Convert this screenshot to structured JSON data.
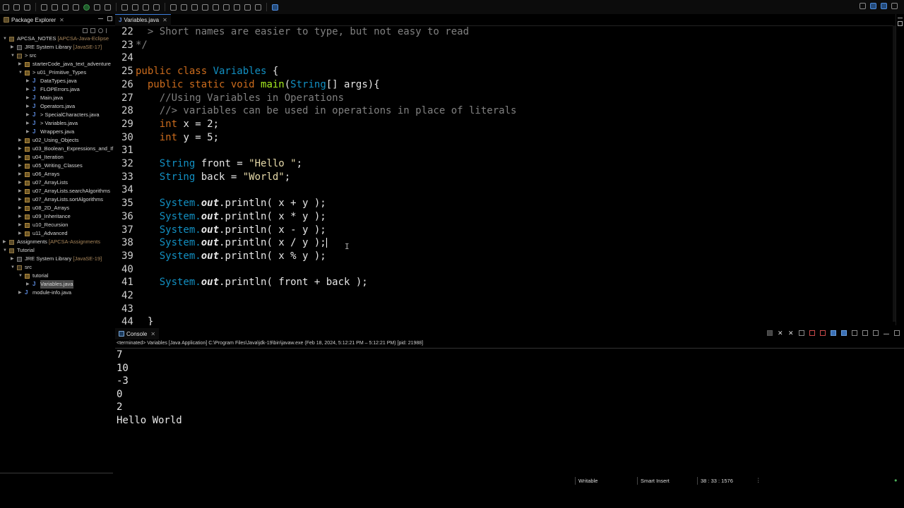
{
  "package_explorer": {
    "tab_label": "Package Explorer",
    "tree": [
      {
        "label": "APCSA_NOTES",
        "decoration": "[APCSA-Java-Eclipse",
        "depth": 0,
        "icon": "project-icon",
        "twisty": "down"
      },
      {
        "label": "JRE System Library",
        "decoration": "[JavaSE-17]",
        "depth": 1,
        "icon": "jre-library-icon",
        "twisty": "right"
      },
      {
        "label": "> src",
        "decoration": "",
        "depth": 1,
        "icon": "source-folder-icon",
        "twisty": "down"
      },
      {
        "label": "starterCode_java_text_adventure",
        "decoration": "",
        "depth": 2,
        "icon": "package-icon",
        "twisty": "right"
      },
      {
        "label": "> u01_Primitive_Types",
        "decoration": "",
        "depth": 2,
        "icon": "package-icon",
        "twisty": "down"
      },
      {
        "label": "DataTypes.java",
        "decoration": "",
        "depth": 3,
        "icon": "java-file-icon",
        "twisty": "right"
      },
      {
        "label": "FLOPErrors.java",
        "decoration": "",
        "depth": 3,
        "icon": "java-file-icon",
        "twisty": "right"
      },
      {
        "label": "Main.java",
        "decoration": "",
        "depth": 3,
        "icon": "java-file-icon",
        "twisty": "right"
      },
      {
        "label": "Operators.java",
        "decoration": "",
        "depth": 3,
        "icon": "java-file-icon",
        "twisty": "right"
      },
      {
        "label": "> SpecialCharacters.java",
        "decoration": "",
        "depth": 3,
        "icon": "java-file-icon",
        "twisty": "right"
      },
      {
        "label": "> Variables.java",
        "decoration": "",
        "depth": 3,
        "icon": "java-file-icon",
        "twisty": "right"
      },
      {
        "label": "Wrappers.java",
        "decoration": "",
        "depth": 3,
        "icon": "java-file-icon",
        "twisty": "right"
      },
      {
        "label": "u02_Using_Objects",
        "decoration": "",
        "depth": 2,
        "icon": "package-icon",
        "twisty": "right"
      },
      {
        "label": "u03_Boolean_Expressions_and_If",
        "decoration": "",
        "depth": 2,
        "icon": "package-icon",
        "twisty": "right"
      },
      {
        "label": "u04_Iteration",
        "decoration": "",
        "depth": 2,
        "icon": "package-icon",
        "twisty": "right"
      },
      {
        "label": "u05_Writing_Classes",
        "decoration": "",
        "depth": 2,
        "icon": "package-icon",
        "twisty": "right"
      },
      {
        "label": "u06_Arrays",
        "decoration": "",
        "depth": 2,
        "icon": "package-icon",
        "twisty": "right"
      },
      {
        "label": "u07_ArrayLists",
        "decoration": "",
        "depth": 2,
        "icon": "package-icon",
        "twisty": "right"
      },
      {
        "label": "u07_ArrayLists.searchAlgorithms",
        "decoration": "",
        "depth": 2,
        "icon": "package-icon",
        "twisty": "right"
      },
      {
        "label": "u07_ArrayLists.sortAlgorithms",
        "decoration": "",
        "depth": 2,
        "icon": "package-icon",
        "twisty": "right"
      },
      {
        "label": "u08_2D_Arrays",
        "decoration": "",
        "depth": 2,
        "icon": "package-icon",
        "twisty": "right"
      },
      {
        "label": "u09_Inheritance",
        "decoration": "",
        "depth": 2,
        "icon": "package-icon",
        "twisty": "right"
      },
      {
        "label": "u10_Recursion",
        "decoration": "",
        "depth": 2,
        "icon": "package-icon",
        "twisty": "right"
      },
      {
        "label": "u11_Advanced",
        "decoration": "",
        "depth": 2,
        "icon": "package-icon",
        "twisty": "right"
      },
      {
        "label": "Assignments",
        "decoration": "[APCSA-Assignments",
        "depth": 0,
        "icon": "project-icon",
        "twisty": "right"
      },
      {
        "label": "Tutorial",
        "decoration": "",
        "depth": 0,
        "icon": "project-icon",
        "twisty": "down"
      },
      {
        "label": "JRE System Library",
        "decoration": "[JavaSE-19]",
        "depth": 1,
        "icon": "jre-library-icon",
        "twisty": "right"
      },
      {
        "label": "src",
        "decoration": "",
        "depth": 1,
        "icon": "source-folder-icon",
        "twisty": "down"
      },
      {
        "label": "tutorial",
        "decoration": "",
        "depth": 2,
        "icon": "package-icon",
        "twisty": "down"
      },
      {
        "label": "Variables.java",
        "decoration": "",
        "depth": 3,
        "icon": "java-file-icon",
        "twisty": "right",
        "selected": true
      },
      {
        "label": "module-info.java",
        "decoration": "",
        "depth": 2,
        "icon": "java-file-icon",
        "twisty": "right"
      }
    ]
  },
  "editor": {
    "tab_label": "Variables.java",
    "lines": [
      {
        "n": "22",
        "parts": [
          {
            "t": "  > Short names are easier to type, but not easy to read",
            "c": "com"
          }
        ]
      },
      {
        "n": "23",
        "parts": [
          {
            "t": "*/",
            "c": "com"
          }
        ]
      },
      {
        "n": "24",
        "parts": []
      },
      {
        "n": "25",
        "parts": [
          {
            "t": "public class ",
            "c": "kw"
          },
          {
            "t": "Variables",
            "c": "cls"
          },
          {
            "t": " {",
            "c": ""
          }
        ]
      },
      {
        "n": "26",
        "parts": [
          {
            "t": "  public static void ",
            "c": "kw"
          },
          {
            "t": "main",
            "c": "mth"
          },
          {
            "t": "(",
            "c": ""
          },
          {
            "t": "String",
            "c": "ty"
          },
          {
            "t": "[] ",
            "c": ""
          },
          {
            "t": "args",
            "c": "arg"
          },
          {
            "t": "){",
            "c": ""
          }
        ]
      },
      {
        "n": "27",
        "parts": [
          {
            "t": "    //Using Variables in Operations",
            "c": "com"
          }
        ]
      },
      {
        "n": "28",
        "parts": [
          {
            "t": "    //> variables can be used in operations in place of literals",
            "c": "com"
          }
        ]
      },
      {
        "n": "29",
        "parts": [
          {
            "t": "    int",
            "c": "kw"
          },
          {
            "t": " x = 2;",
            "c": ""
          }
        ]
      },
      {
        "n": "30",
        "parts": [
          {
            "t": "    int",
            "c": "kw"
          },
          {
            "t": " y = 5;",
            "c": ""
          }
        ]
      },
      {
        "n": "31",
        "parts": []
      },
      {
        "n": "32",
        "parts": [
          {
            "t": "    String",
            "c": "ty"
          },
          {
            "t": " front = ",
            "c": ""
          },
          {
            "t": "\"Hello \"",
            "c": "str"
          },
          {
            "t": ";",
            "c": ""
          }
        ]
      },
      {
        "n": "33",
        "parts": [
          {
            "t": "    String",
            "c": "ty"
          },
          {
            "t": " back = ",
            "c": ""
          },
          {
            "t": "\"World\"",
            "c": "str"
          },
          {
            "t": ";",
            "c": ""
          }
        ]
      },
      {
        "n": "34",
        "parts": []
      },
      {
        "n": "35",
        "parts": [
          {
            "t": "    System.",
            "c": "ty"
          },
          {
            "t": "out",
            "c": "fld"
          },
          {
            "t": ".println( x + y );",
            "c": ""
          }
        ]
      },
      {
        "n": "36",
        "parts": [
          {
            "t": "    System.",
            "c": "ty"
          },
          {
            "t": "out",
            "c": "fld"
          },
          {
            "t": ".println( x * y );",
            "c": ""
          }
        ]
      },
      {
        "n": "37",
        "parts": [
          {
            "t": "    System.",
            "c": "ty"
          },
          {
            "t": "out",
            "c": "fld"
          },
          {
            "t": ".println( x - y );",
            "c": ""
          }
        ]
      },
      {
        "n": "38",
        "parts": [
          {
            "t": "    System.",
            "c": "ty"
          },
          {
            "t": "out",
            "c": "fld"
          },
          {
            "t": ".println( x / y );",
            "c": ""
          }
        ],
        "caret": true
      },
      {
        "n": "39",
        "parts": [
          {
            "t": "    System.",
            "c": "ty"
          },
          {
            "t": "out",
            "c": "fld"
          },
          {
            "t": ".println( x % y );",
            "c": ""
          }
        ]
      },
      {
        "n": "40",
        "parts": []
      },
      {
        "n": "41",
        "parts": [
          {
            "t": "    System.",
            "c": "ty"
          },
          {
            "t": "out",
            "c": "fld"
          },
          {
            "t": ".println( front + back );",
            "c": ""
          }
        ]
      },
      {
        "n": "42",
        "parts": []
      },
      {
        "n": "43",
        "parts": []
      },
      {
        "n": "44",
        "parts": [
          {
            "t": "  }",
            "c": ""
          }
        ]
      }
    ]
  },
  "console": {
    "tab_label": "Console",
    "status": "<terminated> Variables [Java Application] C:\\Program Files\\Java\\jdk-19\\bin\\javaw.exe  (Feb 18, 2024, 5:12:21 PM – 5:12:21 PM) [pid: 21988]",
    "output": [
      "7",
      "10",
      "-3",
      "0",
      "2",
      "Hello World"
    ]
  },
  "statusbar": {
    "mode": "Writable",
    "insert": "Smart Insert",
    "position": "38 : 33 : 1576"
  },
  "colors": {
    "keyword": "#cc6c1d",
    "type": "#1290c3",
    "string": "#e6d9a9",
    "comment": "#808080",
    "method": "#a7ec21",
    "selection": "#4a4a4a",
    "active_tab": "#3b7ddd"
  }
}
